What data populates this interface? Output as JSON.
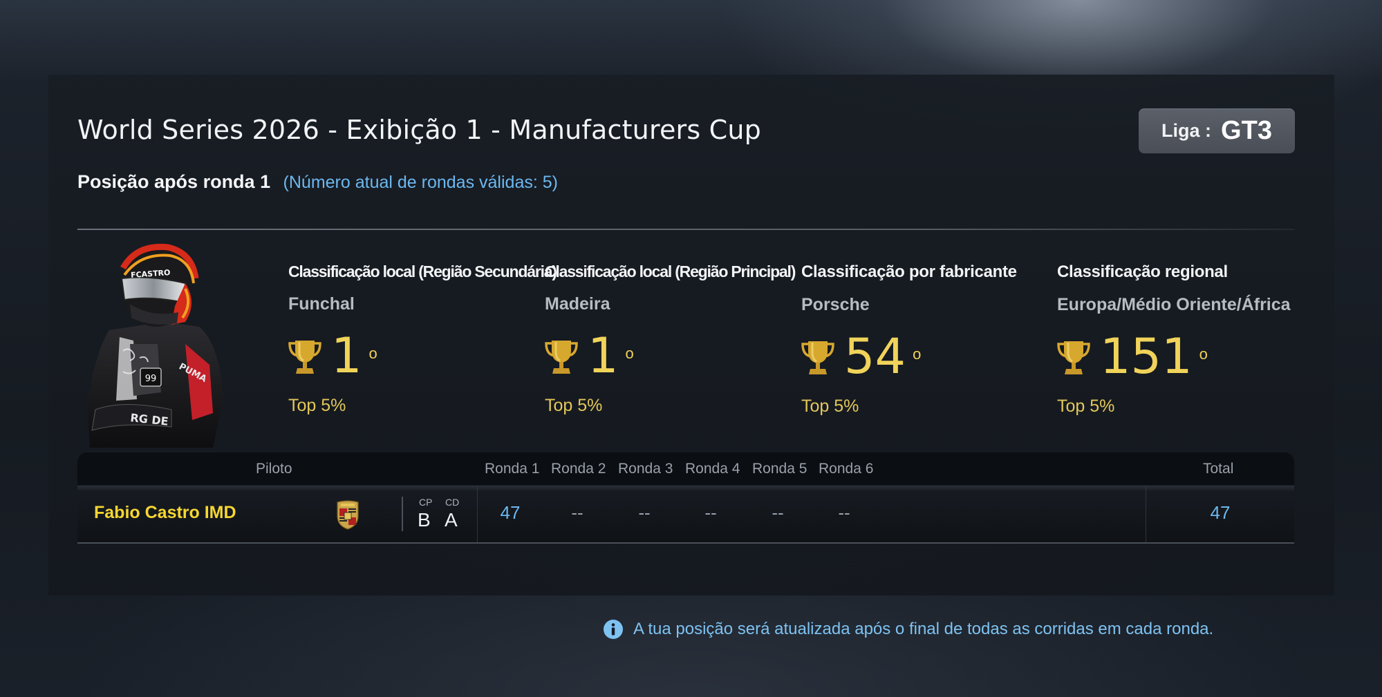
{
  "event": {
    "title": "World Series 2026 - Exibição 1 - Manufacturers Cup",
    "league_label": "Liga :",
    "league_value": "GT3",
    "position_text": "Posição após ronda 1",
    "valid_rounds_text": "(Número atual de rondas válidas: 5)"
  },
  "rankings": [
    {
      "category": "Classificação local (Região Secundária)",
      "region": "Funchal",
      "rank": "1",
      "ordinal": "o",
      "top": "Top 5%"
    },
    {
      "category": "Classificação local (Região Principal)",
      "region": "Madeira",
      "rank": "1",
      "ordinal": "o",
      "top": "Top 5%"
    },
    {
      "category": "Classificação por fabricante",
      "region": "Porsche",
      "rank": "54",
      "ordinal": "o",
      "top": "Top 5%"
    },
    {
      "category": "Classificação regional",
      "region": "Europa/Médio Oriente/África",
      "rank": "151",
      "ordinal": "o",
      "top": "Top 5%"
    }
  ],
  "table": {
    "headers": {
      "driver": "Piloto",
      "rounds": [
        "Ronda 1",
        "Ronda 2",
        "Ronda 3",
        "Ronda 4",
        "Ronda 5",
        "Ronda 6"
      ],
      "total": "Total"
    },
    "row": {
      "driver": "Fabio Castro IMD",
      "cp_label": "CP",
      "cd_label": "CD",
      "cp_value": "B",
      "cd_value": "A",
      "rounds": [
        "47",
        "--",
        "--",
        "--",
        "--",
        "--"
      ],
      "total": "47"
    }
  },
  "footer_note": "A tua posição será atualizada após o final de todas as corridas em cada ronda.",
  "colors": {
    "gold": "#f0d35a",
    "blue": "#6cb8f0",
    "driver_name": "#f6d632"
  }
}
